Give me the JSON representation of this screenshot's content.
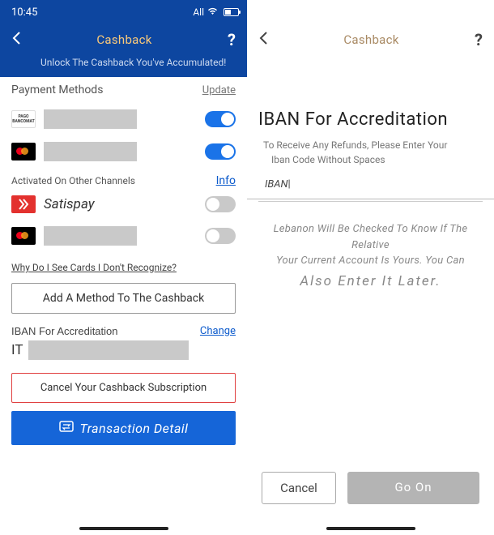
{
  "left": {
    "status": {
      "time": "10:45",
      "carrier": "All"
    },
    "header": {
      "title": "Cashback"
    },
    "unlock_text": "Unlock The Cashback You've Accumulated!",
    "payment_methods": {
      "title": "Payment Methods",
      "update": "Update",
      "items": [
        {
          "logo": "bancomat",
          "enabled": true
        },
        {
          "logo": "mastercard",
          "enabled": true
        }
      ]
    },
    "other_channels": {
      "title": "Activated On Other Channels",
      "info": "Info",
      "items": [
        {
          "logo": "satispay",
          "label": "Satispay",
          "enabled": false
        },
        {
          "logo": "mastercard",
          "enabled": false
        }
      ]
    },
    "why_link": "Why Do I See Cards I Don't Recognize?",
    "add_method": "Add A Method To The Cashback",
    "iban_section": {
      "label": "IBAN For Accreditation",
      "change": "Change",
      "prefix": "IT"
    },
    "cancel_sub": "Cancel Your Cashback Subscription",
    "transaction": "Transaction Detail"
  },
  "right": {
    "header": {
      "title": "Cashback"
    },
    "iban_title": "IBAN For Accreditation",
    "desc1": "To Receive Any Refunds, Please Enter Your",
    "desc2": "Iban Code Without Spaces",
    "input_label": "IBAN",
    "caution1": "Lebanon Will Be Checked To Know If The Relative",
    "caution2": "Your Current Account Is Yours. You Can",
    "caution3": "Also Enter It Later.",
    "cancel": "Cancel",
    "go_on": "Go On"
  }
}
